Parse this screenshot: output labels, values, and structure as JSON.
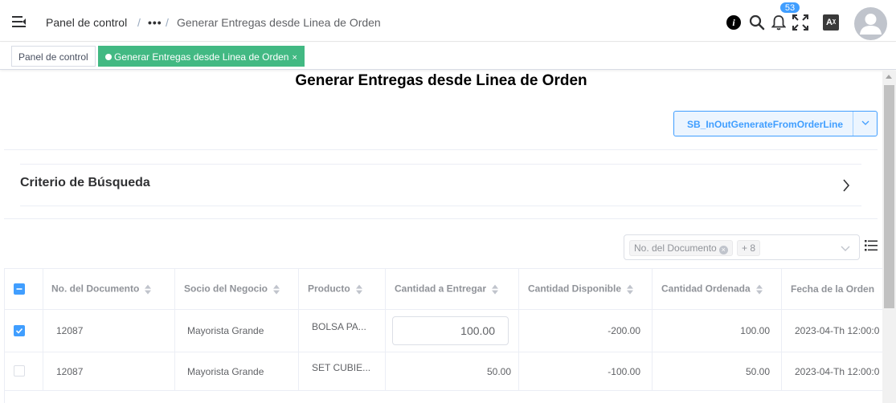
{
  "navbar": {
    "breadcrumb": {
      "home": "Panel de control",
      "separator": "/",
      "ellipsis": "•••",
      "current": "Generar Entregas desde Linea de Orden"
    },
    "notifications_count": "53",
    "lang_label": "Aᵡ",
    "icons": [
      "hamburger-icon",
      "info-icon",
      "search-icon",
      "bell-icon",
      "fullscreen-icon",
      "translate-icon",
      "avatar"
    ]
  },
  "tags": {
    "home": "Panel de control",
    "active": "Generar Entregas desde Linea de Orden",
    "close": "×"
  },
  "page": {
    "title": "Generar Entregas desde Linea de Orden",
    "process_button": "SB_InOutGenerateFromOrderLine",
    "criteria_title": "Criterio de Búsqueda"
  },
  "column_selector": {
    "selected_chip": "No. del Documento",
    "more_chip": "+ 8"
  },
  "table": {
    "headers": [
      "No. del Documento",
      "Socio del Negocio",
      "Producto",
      "Cantidad a Entregar",
      "Cantidad Disponible",
      "Cantidad Ordenada",
      "Fecha de la Orden"
    ],
    "rows": [
      {
        "checked": true,
        "document_no": "12087",
        "business_partner": "Mayorista Grande",
        "product": "BOLSA PA...",
        "qty_to_deliver": "100.00",
        "qty_available": "-200.00",
        "qty_ordered": "100.00",
        "order_date": "2023-04-Th 12:00:0"
      },
      {
        "checked": false,
        "document_no": "12087",
        "business_partner": "Mayorista Grande",
        "product": "SET CUBIE...",
        "qty_to_deliver": "50.00",
        "qty_available": "-100.00",
        "qty_ordered": "50.00",
        "order_date": "2023-04-Th 12:00:0"
      }
    ]
  },
  "colors": {
    "primary": "#409eff",
    "tag_active": "#42b983",
    "border": "#ebeef5",
    "header_text": "#909399"
  }
}
